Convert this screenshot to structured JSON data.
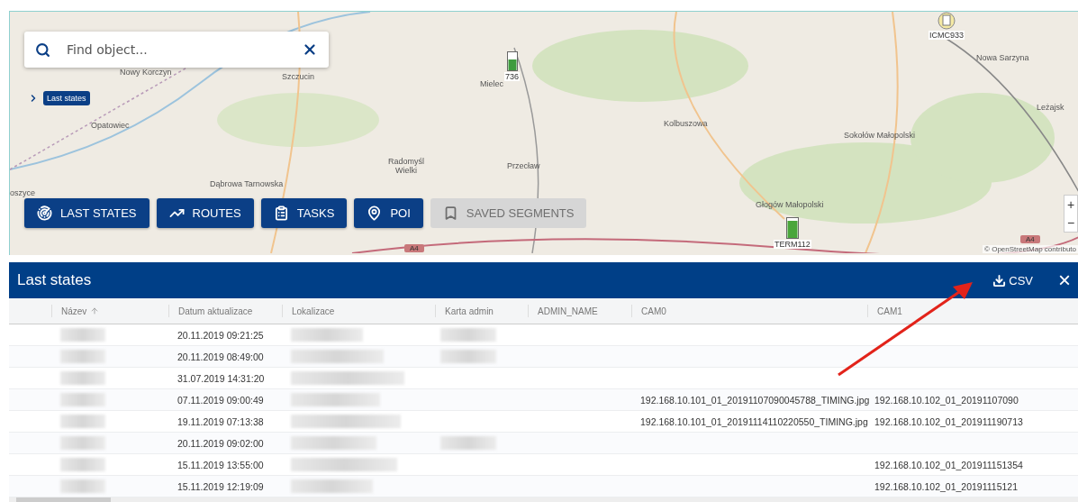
{
  "search": {
    "placeholder": "Find object..."
  },
  "breadcrumb": {
    "label": "Last states"
  },
  "map": {
    "places": [
      "Nowy Korczyn",
      "Szczucin",
      "Opatowiec",
      "oszyce",
      "Dąbrowa Tarnowska",
      "Radomyśl\nWielki",
      "Mielec",
      "Przecław",
      "Kolbuszowa",
      "Sokołów Małopolski",
      "Głogów Małopolski",
      "Nowa Sarzyna",
      "Leżajsk"
    ],
    "markers": [
      {
        "label": "736",
        "kind": "battery"
      },
      {
        "label": "ICMC933",
        "kind": "round"
      },
      {
        "label": "TERM112",
        "kind": "block"
      }
    ],
    "road_signs": [
      "A4",
      "A4"
    ],
    "zoom": [
      "+",
      "−"
    ],
    "attribution": "© OpenStreetMap contributo"
  },
  "toolbar": [
    {
      "label": "LAST STATES",
      "disabled": false
    },
    {
      "label": "ROUTES",
      "disabled": false
    },
    {
      "label": "TASKS",
      "disabled": false
    },
    {
      "label": "POI",
      "disabled": false
    },
    {
      "label": "SAVED SEGMENTS",
      "disabled": true
    }
  ],
  "panel": {
    "title": "Last states",
    "export_label": "CSV",
    "close": "×"
  },
  "table": {
    "columns": [
      {
        "label": "Název",
        "sorted": true
      },
      {
        "label": "Datum aktualizace",
        "sorted": false
      },
      {
        "label": "Lokalizace",
        "sorted": false
      },
      {
        "label": "Karta admin",
        "sorted": false
      },
      {
        "label": "ADMIN_NAME",
        "sorted": false
      },
      {
        "label": "CAM0",
        "sorted": false
      },
      {
        "label": "CAM1",
        "sorted": false
      }
    ],
    "rows": [
      {
        "name_hidden": true,
        "date": "20.11.2019 09:21:25",
        "location_hidden": true,
        "card_hidden": true
      },
      {
        "name_hidden": true,
        "date": "20.11.2019 08:49:00",
        "location_hidden": true,
        "card_hidden": true
      },
      {
        "name_hidden": true,
        "date": "31.07.2019 14:31:20",
        "location_hidden": true,
        "card_hidden": false
      },
      {
        "name_hidden": true,
        "date": "07.11.2019 09:00:49",
        "location_hidden": true,
        "card_hidden": false,
        "cam0": "192.168.10.101_01_20191107090045788_TIMING.jpg",
        "cam1": "192.168.10.102_01_20191107090"
      },
      {
        "name_hidden": true,
        "date": "19.11.2019 07:13:38",
        "location_hidden": true,
        "card_hidden": false,
        "cam0": "192.168.10.101_01_20191114110220550_TIMING.jpg",
        "cam1": "192.168.10.102_01_201911190713"
      },
      {
        "name_hidden": true,
        "date": "20.11.2019 09:02:00",
        "location_hidden": true,
        "card_hidden": true
      },
      {
        "name_hidden": true,
        "date": "15.11.2019 13:55:00",
        "location_hidden": true,
        "card_hidden": false,
        "cam1": "192.168.10.102_01_201911151354"
      },
      {
        "name_hidden": true,
        "date": "15.11.2019 12:19:09",
        "location_hidden": true,
        "card_hidden": false,
        "cam1": "192.168.10.102_01_20191115121"
      }
    ]
  }
}
